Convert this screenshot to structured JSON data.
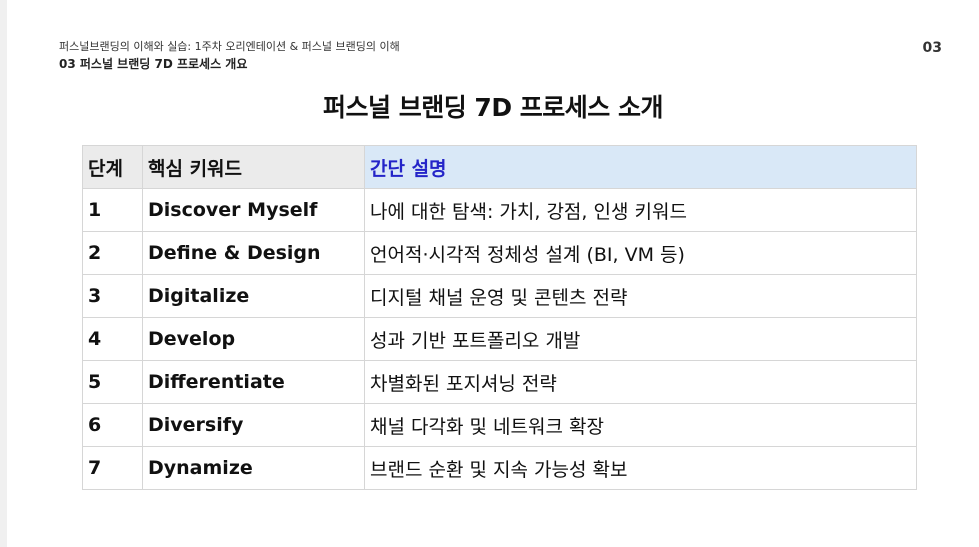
{
  "header": {
    "breadcrumb": "퍼스널브랜딩의 이해와 실습: 1주차 오리엔테이션 &  퍼스널 브랜딩의 이해",
    "section": "03 퍼스널 브랜딩 7D 프로세스 개요",
    "page_number": "03"
  },
  "title": "퍼스널 브랜딩 7D 프로세스 소개",
  "table": {
    "headers": [
      "단계",
      "핵심 키워드",
      "간단 설명"
    ],
    "rows": [
      {
        "step": "1",
        "keyword": "Discover Myself",
        "desc": "나에 대한 탐색: 가치, 강점, 인생 키워드"
      },
      {
        "step": "2",
        "keyword": "Define & Design",
        "desc": "언어적·시각적 정체성 설계 (BI, VM 등)"
      },
      {
        "step": "3",
        "keyword": "Digitalize",
        "desc": "디지털 채널 운영 및 콘텐츠 전략"
      },
      {
        "step": "4",
        "keyword": "Develop",
        "desc": "성과 기반 포트폴리오 개발"
      },
      {
        "step": "5",
        "keyword": "Differentiate",
        "desc": "차별화된 포지셔닝 전략"
      },
      {
        "step": "6",
        "keyword": "Diversify",
        "desc": "채널 다각화 및 네트워크 확장"
      },
      {
        "step": "7",
        "keyword": "Dynamize",
        "desc": "브랜드 순환 및 지속 가능성 확보"
      }
    ]
  },
  "colors": {
    "header_bg": "#ebebeb",
    "desc_header_bg": "#d9e8f7",
    "desc_header_text": "#2424c8"
  }
}
